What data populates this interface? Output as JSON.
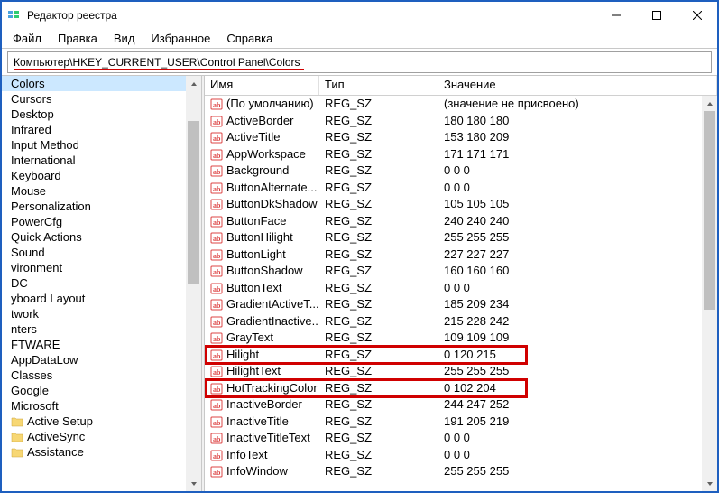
{
  "window": {
    "title": "Редактор реестра"
  },
  "menu": {
    "file": "Файл",
    "edit": "Правка",
    "view": "Вид",
    "favorites": "Избранное",
    "help": "Справка"
  },
  "address": {
    "path": "Компьютер\\HKEY_CURRENT_USER\\Control Panel\\Colors"
  },
  "columns": {
    "name": "Имя",
    "type": "Тип",
    "value": "Значение"
  },
  "tree": {
    "items": [
      {
        "label": "Colors",
        "selected": true,
        "folder": false
      },
      {
        "label": "Cursors",
        "folder": false
      },
      {
        "label": "Desktop",
        "folder": false
      },
      {
        "label": "Infrared",
        "folder": false
      },
      {
        "label": "Input Method",
        "folder": false
      },
      {
        "label": "International",
        "folder": false
      },
      {
        "label": "Keyboard",
        "folder": false
      },
      {
        "label": "Mouse",
        "folder": false
      },
      {
        "label": "Personalization",
        "folder": false
      },
      {
        "label": "PowerCfg",
        "folder": false
      },
      {
        "label": "Quick Actions",
        "folder": false
      },
      {
        "label": "Sound",
        "folder": false
      },
      {
        "label": "vironment",
        "folder": false
      },
      {
        "label": "DC",
        "folder": false
      },
      {
        "label": "yboard Layout",
        "folder": false
      },
      {
        "label": "twork",
        "folder": false
      },
      {
        "label": "nters",
        "folder": false
      },
      {
        "label": "FTWARE",
        "folder": false
      },
      {
        "label": "AppDataLow",
        "folder": false
      },
      {
        "label": "Classes",
        "folder": false
      },
      {
        "label": "Google",
        "folder": false
      },
      {
        "label": "Microsoft",
        "folder": false
      },
      {
        "label": "Active Setup",
        "folder": true
      },
      {
        "label": "ActiveSync",
        "folder": true
      },
      {
        "label": "Assistance",
        "folder": true
      }
    ]
  },
  "values": {
    "rows": [
      {
        "name": "(По умолчанию)",
        "type": "REG_SZ",
        "value": "(значение не присвоено)",
        "hl": false
      },
      {
        "name": "ActiveBorder",
        "type": "REG_SZ",
        "value": "180 180 180",
        "hl": false
      },
      {
        "name": "ActiveTitle",
        "type": "REG_SZ",
        "value": "153 180 209",
        "hl": false
      },
      {
        "name": "AppWorkspace",
        "type": "REG_SZ",
        "value": "171 171 171",
        "hl": false
      },
      {
        "name": "Background",
        "type": "REG_SZ",
        "value": "0 0 0",
        "hl": false
      },
      {
        "name": "ButtonAlternate...",
        "type": "REG_SZ",
        "value": "0 0 0",
        "hl": false
      },
      {
        "name": "ButtonDkShadow",
        "type": "REG_SZ",
        "value": "105 105 105",
        "hl": false
      },
      {
        "name": "ButtonFace",
        "type": "REG_SZ",
        "value": "240 240 240",
        "hl": false
      },
      {
        "name": "ButtonHilight",
        "type": "REG_SZ",
        "value": "255 255 255",
        "hl": false
      },
      {
        "name": "ButtonLight",
        "type": "REG_SZ",
        "value": "227 227 227",
        "hl": false
      },
      {
        "name": "ButtonShadow",
        "type": "REG_SZ",
        "value": "160 160 160",
        "hl": false
      },
      {
        "name": "ButtonText",
        "type": "REG_SZ",
        "value": "0 0 0",
        "hl": false
      },
      {
        "name": "GradientActiveT...",
        "type": "REG_SZ",
        "value": "185 209 234",
        "hl": false
      },
      {
        "name": "GradientInactive...",
        "type": "REG_SZ",
        "value": "215 228 242",
        "hl": false
      },
      {
        "name": "GrayText",
        "type": "REG_SZ",
        "value": "109 109 109",
        "hl": false
      },
      {
        "name": "Hilight",
        "type": "REG_SZ",
        "value": "0 120 215",
        "hl": true
      },
      {
        "name": "HilightText",
        "type": "REG_SZ",
        "value": "255 255 255",
        "hl": false
      },
      {
        "name": "HotTrackingColor",
        "type": "REG_SZ",
        "value": "0 102 204",
        "hl": true
      },
      {
        "name": "InactiveBorder",
        "type": "REG_SZ",
        "value": "244 247 252",
        "hl": false
      },
      {
        "name": "InactiveTitle",
        "type": "REG_SZ",
        "value": "191 205 219",
        "hl": false
      },
      {
        "name": "InactiveTitleText",
        "type": "REG_SZ",
        "value": "0 0 0",
        "hl": false
      },
      {
        "name": "InfoText",
        "type": "REG_SZ",
        "value": "0 0 0",
        "hl": false
      },
      {
        "name": "InfoWindow",
        "type": "REG_SZ",
        "value": "255 255 255",
        "hl": false
      }
    ]
  },
  "icons": {
    "regedit": "regedit-app-icon",
    "min": "minimize-icon",
    "max": "maximize-icon",
    "close": "close-icon"
  },
  "highlight_color": "#d00000"
}
